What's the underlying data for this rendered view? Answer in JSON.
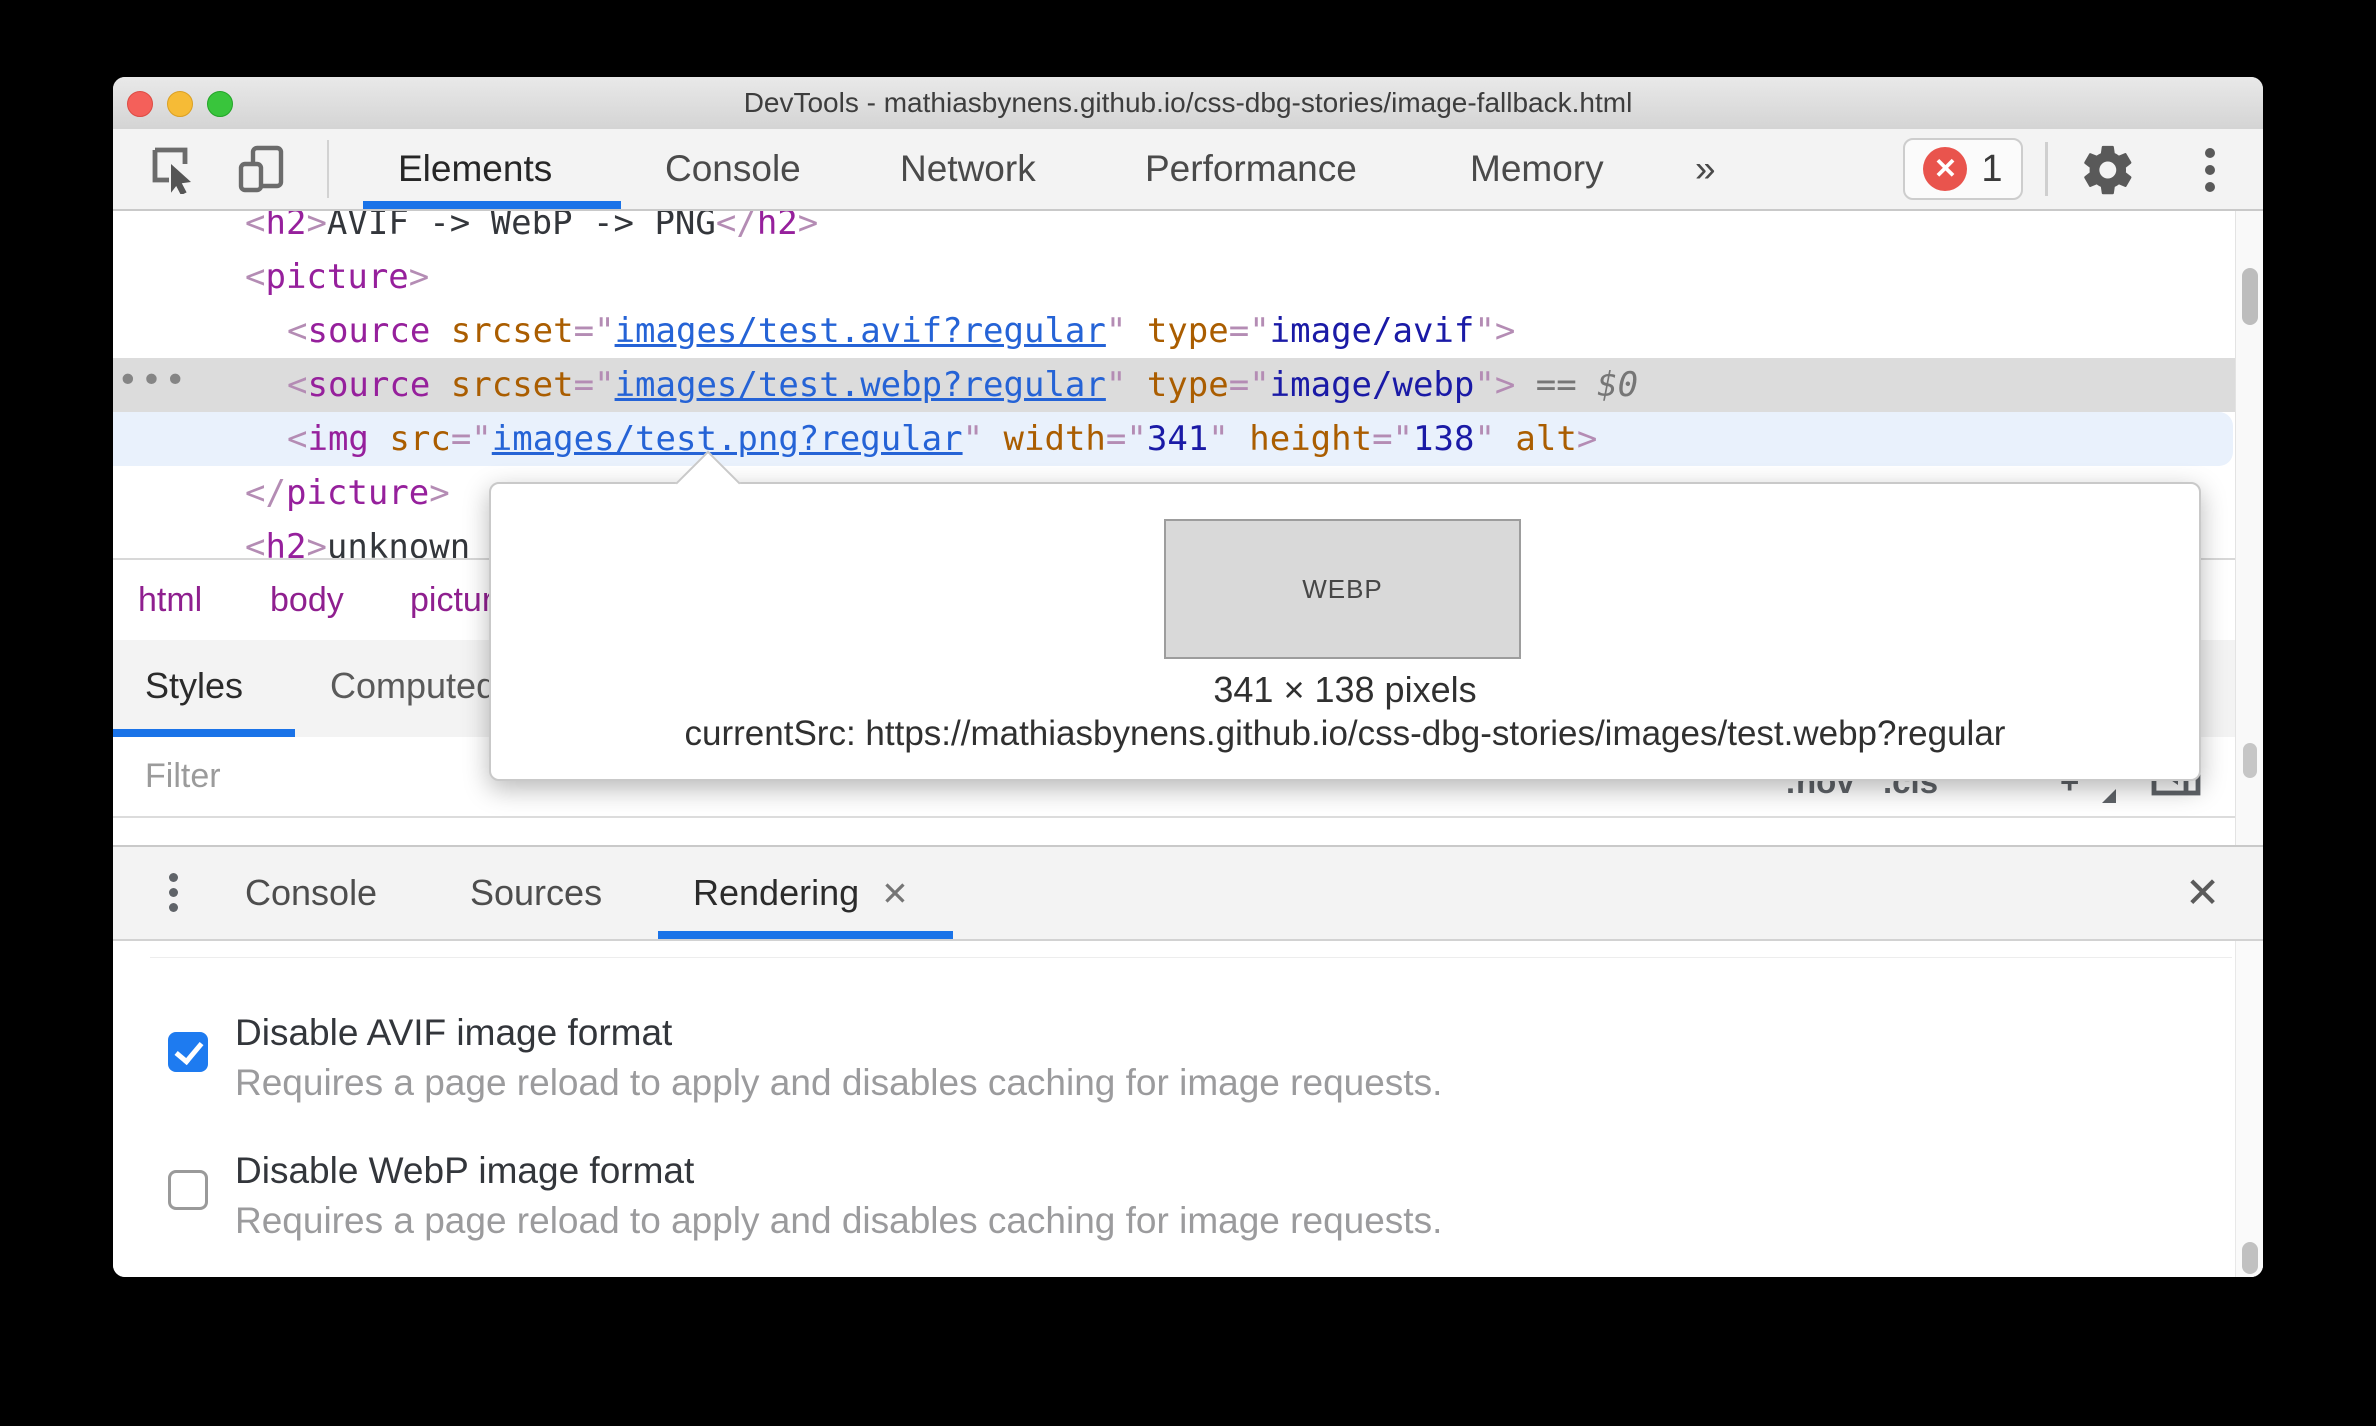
{
  "window": {
    "title": "DevTools - mathiasbynens.github.io/css-dbg-stories/image-fallback.html"
  },
  "toolbar": {
    "selected_tab": "Elements",
    "tabs": [
      "Elements",
      "Console",
      "Network",
      "Performance",
      "Memory",
      "»"
    ],
    "error_badge_count": "1",
    "icons": [
      "inspect-icon",
      "device-toolbar-icon",
      "settings-gear-icon",
      "more-options-kebab-icon"
    ]
  },
  "elements_panel": {
    "lines": [
      {
        "tokens": [
          {
            "c": "pun",
            "t": "<"
          },
          {
            "c": "tag",
            "t": "h2"
          },
          {
            "c": "pun",
            "t": ">"
          },
          {
            "c": "txt",
            "t": "AVIF -> WebP -> PNG"
          },
          {
            "c": "pun",
            "t": "</"
          },
          {
            "c": "tag",
            "t": "h2"
          },
          {
            "c": "pun",
            "t": ">"
          }
        ]
      },
      {
        "tokens": [
          {
            "c": "pun",
            "t": "<"
          },
          {
            "c": "tag",
            "t": "picture"
          },
          {
            "c": "pun",
            "t": ">"
          }
        ]
      },
      {
        "tokens": [
          {
            "c": "pun",
            "t": "<"
          },
          {
            "c": "tag",
            "t": "source"
          },
          {
            "c": "txt",
            "t": " "
          },
          {
            "c": "attr",
            "t": "srcset"
          },
          {
            "c": "pun",
            "t": "=\""
          },
          {
            "c": "link",
            "t": "images/test.avif?regular"
          },
          {
            "c": "pun",
            "t": "\""
          },
          {
            "c": "txt",
            "t": " "
          },
          {
            "c": "attr",
            "t": "type"
          },
          {
            "c": "pun",
            "t": "=\""
          },
          {
            "c": "val",
            "t": "image/avif"
          },
          {
            "c": "pun",
            "t": "\">"
          }
        ]
      },
      {
        "tokens": [
          {
            "c": "pun",
            "t": "<"
          },
          {
            "c": "tag",
            "t": "source"
          },
          {
            "c": "txt",
            "t": " "
          },
          {
            "c": "attr",
            "t": "srcset"
          },
          {
            "c": "pun",
            "t": "=\""
          },
          {
            "c": "link",
            "t": "images/test.webp?regular"
          },
          {
            "c": "pun",
            "t": "\""
          },
          {
            "c": "txt",
            "t": " "
          },
          {
            "c": "attr",
            "t": "type"
          },
          {
            "c": "pun",
            "t": "=\""
          },
          {
            "c": "val",
            "t": "image/webp"
          },
          {
            "c": "pun",
            "t": "\">"
          },
          {
            "c": "meta",
            "t": " == $0"
          }
        ]
      },
      {
        "tokens": [
          {
            "c": "pun",
            "t": "<"
          },
          {
            "c": "tag",
            "t": "img"
          },
          {
            "c": "txt",
            "t": " "
          },
          {
            "c": "attr",
            "t": "src"
          },
          {
            "c": "pun",
            "t": "=\""
          },
          {
            "c": "link",
            "t": "images/test.png?regular"
          },
          {
            "c": "pun",
            "t": "\""
          },
          {
            "c": "txt",
            "t": " "
          },
          {
            "c": "attr",
            "t": "width"
          },
          {
            "c": "pun",
            "t": "=\""
          },
          {
            "c": "val",
            "t": "341"
          },
          {
            "c": "pun",
            "t": "\""
          },
          {
            "c": "txt",
            "t": " "
          },
          {
            "c": "attr",
            "t": "height"
          },
          {
            "c": "pun",
            "t": "=\""
          },
          {
            "c": "val",
            "t": "138"
          },
          {
            "c": "pun",
            "t": "\""
          },
          {
            "c": "txt",
            "t": " "
          },
          {
            "c": "attr",
            "t": "alt"
          },
          {
            "c": "pun",
            "t": ">"
          }
        ]
      },
      {
        "tokens": [
          {
            "c": "pun",
            "t": "</"
          },
          {
            "c": "tag",
            "t": "picture"
          },
          {
            "c": "pun",
            "t": ">"
          }
        ]
      },
      {
        "tokens": [
          {
            "c": "pun",
            "t": "<"
          },
          {
            "c": "tag",
            "t": "h2"
          },
          {
            "c": "pun",
            "t": ">"
          },
          {
            "c": "txt",
            "t": "unknown"
          }
        ]
      }
    ],
    "breadcrumbs": [
      "html",
      "body",
      "picture"
    ]
  },
  "tooltip": {
    "image_label": "WEBP",
    "dimensions_text": "341 × 138 pixels",
    "current_src_text": "currentSrc: https://mathiasbynens.github.io/css-dbg-stories/images/test.webp?regular"
  },
  "styles_panel": {
    "tabs": [
      "Styles",
      "Computed"
    ],
    "selected_tab": "Styles",
    "filter_placeholder": "Filter",
    "toolbar_buttons": [
      ":hov",
      ".cls",
      "+"
    ],
    "icons": [
      "toggle-sidebar-icon"
    ]
  },
  "drawer": {
    "selected_tab": "Rendering",
    "tabs": [
      {
        "label": "Console"
      },
      {
        "label": "Sources"
      },
      {
        "label": "Rendering",
        "closable": true
      }
    ],
    "close_glyph": "✕",
    "icons": [
      "drawer-menu-kebab-icon",
      "drawer-close-icon"
    ]
  },
  "rendering_panel": {
    "options": [
      {
        "label": "Disable AVIF image format",
        "description": "Requires a page reload to apply and disables caching for image requests.",
        "checked": true
      },
      {
        "label": "Disable WebP image format",
        "description": "Requires a page reload to apply and disables caching for image requests.",
        "checked": false
      }
    ]
  },
  "colors": {
    "accent": "#1a73e8",
    "cbblue": "#1e7bf0",
    "errred": "#e9544d",
    "selrow": "#dcdcdc",
    "hovrow": "#e9f1fc",
    "tag": "#96209c",
    "attr": "#aa5d00",
    "val": "#1a1aa6",
    "link": "#2563d6"
  }
}
